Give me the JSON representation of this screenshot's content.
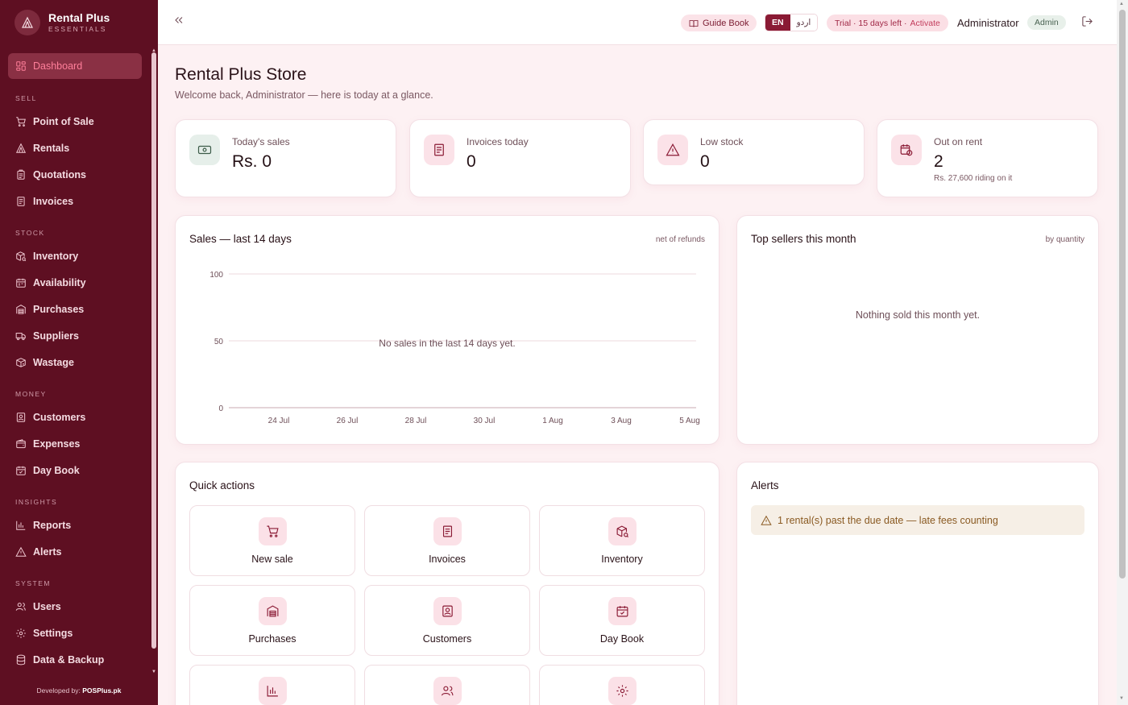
{
  "brand": {
    "name": "Rental Plus",
    "sub": "ESSENTIALS"
  },
  "sidebar": {
    "items": [
      {
        "label": "Dashboard",
        "icon": "dashboard-icon"
      },
      {
        "label": "Point of Sale",
        "icon": "cart-icon"
      },
      {
        "label": "Rentals",
        "icon": "tent-icon"
      },
      {
        "label": "Quotations",
        "icon": "clipboard-icon"
      },
      {
        "label": "Invoices",
        "icon": "invoice-icon"
      },
      {
        "label": "Inventory",
        "icon": "box-search-icon"
      },
      {
        "label": "Availability",
        "icon": "calendar-icon"
      },
      {
        "label": "Purchases",
        "icon": "warehouse-icon"
      },
      {
        "label": "Suppliers",
        "icon": "truck-icon"
      },
      {
        "label": "Wastage",
        "icon": "box-broken-icon"
      },
      {
        "label": "Customers",
        "icon": "contact-card-icon"
      },
      {
        "label": "Expenses",
        "icon": "wallet-icon"
      },
      {
        "label": "Day Book",
        "icon": "calendar-check-icon"
      },
      {
        "label": "Reports",
        "icon": "bar-chart-icon"
      },
      {
        "label": "Alerts",
        "icon": "warning-icon"
      },
      {
        "label": "Users",
        "icon": "users-icon"
      },
      {
        "label": "Settings",
        "icon": "gear-icon"
      },
      {
        "label": "Data & Backup",
        "icon": "database-icon"
      }
    ],
    "sections": [
      "SELL",
      "STOCK",
      "MONEY",
      "INSIGHTS",
      "SYSTEM"
    ],
    "credit_prefix": "Developed by:",
    "credit_name": "POSPlus.pk"
  },
  "topbar": {
    "guide_label": "Guide Book",
    "lang_en": "EN",
    "lang_ur": "اردو",
    "trial_text": "Trial · 15 days left ·",
    "trial_action": "Activate",
    "user_name": "Administrator",
    "role": "Admin"
  },
  "main": {
    "title": "Rental Plus Store",
    "subtitle": "Welcome back, Administrator — here is today at a glance."
  },
  "stats": [
    {
      "label": "Today's sales",
      "value": "Rs. 0",
      "icon": "cash-icon",
      "note": ""
    },
    {
      "label": "Invoices today",
      "value": "0",
      "icon": "invoice-icon",
      "note": ""
    },
    {
      "label": "Low stock",
      "value": "0",
      "icon": "warning-icon",
      "note": ""
    },
    {
      "label": "Out on rent",
      "value": "2",
      "icon": "calendar-clock-icon",
      "note": "Rs. 27,600 riding on it"
    }
  ],
  "sales_card": {
    "title": "Sales — last 14 days",
    "tag": "net of refunds",
    "empty": "No sales in the last 14 days yet."
  },
  "chart_data": {
    "type": "line",
    "x": [
      "24 Jul",
      "26 Jul",
      "28 Jul",
      "30 Jul",
      "1 Aug",
      "3 Aug",
      "5 Aug"
    ],
    "y_ticks": [
      0,
      50,
      100
    ],
    "ylim": [
      0,
      100
    ],
    "series": [],
    "grid": true
  },
  "top_sellers": {
    "title": "Top sellers this month",
    "tag": "by quantity",
    "empty": "Nothing sold this month yet."
  },
  "quick_actions": {
    "title": "Quick actions",
    "items": [
      {
        "label": "New sale",
        "icon": "cart-icon"
      },
      {
        "label": "Invoices",
        "icon": "invoice-icon"
      },
      {
        "label": "Inventory",
        "icon": "box-search-icon"
      },
      {
        "label": "Purchases",
        "icon": "warehouse-icon"
      },
      {
        "label": "Customers",
        "icon": "contact-card-icon"
      },
      {
        "label": "Day Book",
        "icon": "calendar-check-icon"
      },
      {
        "label": "",
        "icon": "bar-chart-icon"
      },
      {
        "label": "",
        "icon": "users-icon"
      },
      {
        "label": "",
        "icon": "gear-icon"
      }
    ]
  },
  "alerts": {
    "title": "Alerts",
    "items": [
      {
        "text": "1 rental(s) past the due date — late fees counting",
        "icon": "warning-icon"
      }
    ]
  }
}
